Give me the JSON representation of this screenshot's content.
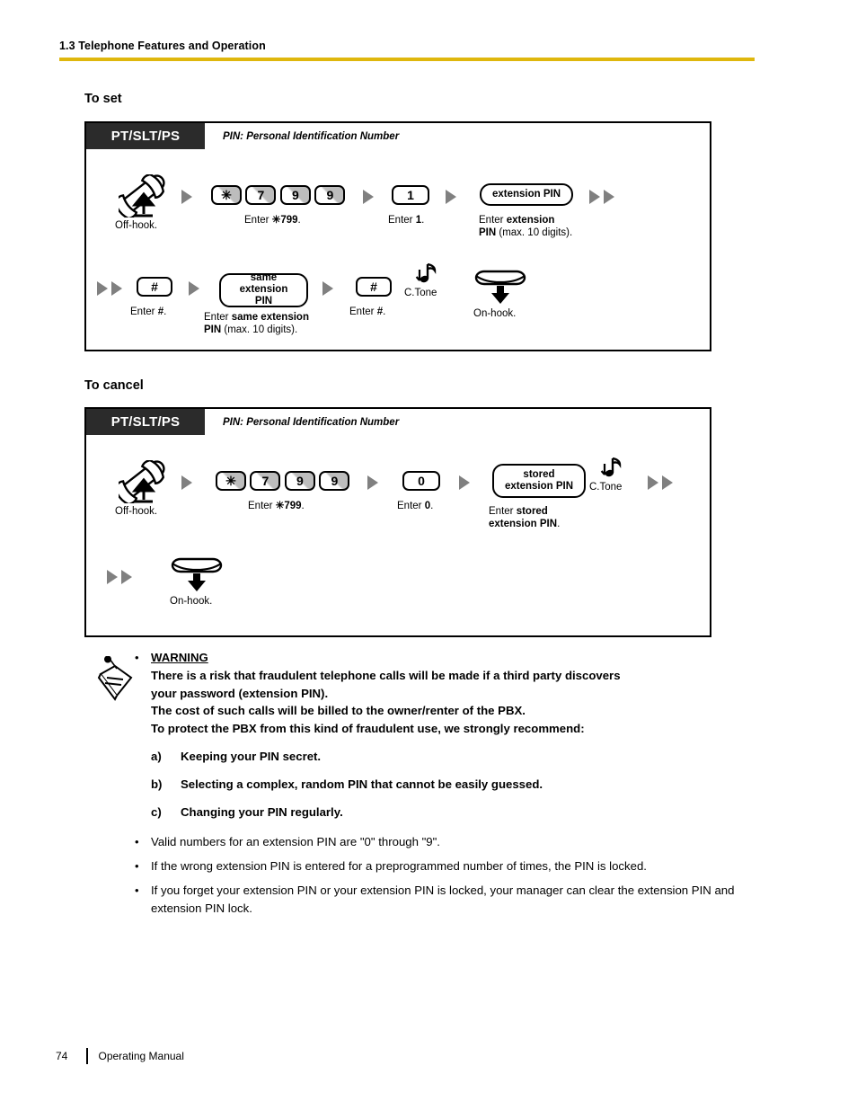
{
  "header": {
    "title": "1.3 Telephone Features and Operation",
    "rule_color": "#dfb70d"
  },
  "sections": [
    {
      "heading": "To set",
      "diagram": {
        "tag": "PT/SLT/PS",
        "note": "PIN: Personal Identification Number",
        "rows": [
          {
            "steps": [
              {
                "type": "offhook-icon",
                "icon": "handset-offhook-icon",
                "caption": "Off-hook."
              },
              {
                "type": "arrow",
                "icon": "step-arrow-icon"
              },
              {
                "type": "keys",
                "keys": [
                  "✳",
                  "7",
                  "9",
                  "9"
                ],
                "caption_pre": "Enter ",
                "caption_bold": "✳799",
                "caption_post": "."
              },
              {
                "type": "arrow",
                "icon": "step-arrow-icon"
              },
              {
                "type": "key-plain",
                "label": "1",
                "caption_pre": "Enter ",
                "caption_bold": "1",
                "caption_post": "."
              },
              {
                "type": "arrow",
                "icon": "step-arrow-icon"
              },
              {
                "type": "pill",
                "label": "extension PIN",
                "caption_line1_pre": "Enter ",
                "caption_line1_bold": "extension",
                "caption_line2_bold": "PIN",
                "caption_line2_post": " (max. 10 digits)."
              },
              {
                "type": "arrow-pair",
                "icon": "continuation-arrow-icon"
              }
            ]
          },
          {
            "steps": [
              {
                "type": "arrow-pair",
                "icon": "continuation-arrow-icon"
              },
              {
                "type": "key-hash",
                "label": "#",
                "caption_pre": "Enter ",
                "caption_bold": "#",
                "caption_post": "."
              },
              {
                "type": "arrow",
                "icon": "step-arrow-icon"
              },
              {
                "type": "pill",
                "label_line1": "same",
                "label_line2": "extension PIN",
                "caption_line1_pre": "Enter ",
                "caption_line1_bold": "same extension",
                "caption_line2_bold": "PIN",
                "caption_line2_post": " (max. 10 digits)."
              },
              {
                "type": "arrow",
                "icon": "step-arrow-icon"
              },
              {
                "type": "key-hash",
                "label": "#",
                "caption_pre": "Enter ",
                "caption_bold": "#",
                "caption_post": "."
              },
              {
                "type": "ctone",
                "icon": "confirmation-tone-icon",
                "label": "C.Tone"
              },
              {
                "type": "onhook-icon",
                "icon": "handset-onhook-icon",
                "caption": "On-hook."
              }
            ]
          }
        ]
      }
    },
    {
      "heading": "To cancel",
      "diagram": {
        "tag": "PT/SLT/PS",
        "note": "PIN: Personal Identification Number",
        "rows": [
          {
            "steps": [
              {
                "type": "offhook-icon",
                "icon": "handset-offhook-icon",
                "caption": "Off-hook."
              },
              {
                "type": "arrow",
                "icon": "step-arrow-icon"
              },
              {
                "type": "keys",
                "keys": [
                  "✳",
                  "7",
                  "9",
                  "9"
                ],
                "caption_pre": "Enter ",
                "caption_bold": "✳799",
                "caption_post": "."
              },
              {
                "type": "arrow",
                "icon": "step-arrow-icon"
              },
              {
                "type": "key-plain",
                "label": "0",
                "caption_pre": "Enter ",
                "caption_bold": "0",
                "caption_post": "."
              },
              {
                "type": "arrow",
                "icon": "step-arrow-icon"
              },
              {
                "type": "pill",
                "label_line1": "stored",
                "label_line2": "extension PIN",
                "caption_line1_pre": "Enter ",
                "caption_line1_bold": "stored",
                "caption_line2_bold": "extension PIN",
                "caption_line2_post": "."
              },
              {
                "type": "ctone",
                "icon": "confirmation-tone-icon",
                "label": "C.Tone"
              },
              {
                "type": "arrow-pair",
                "icon": "continuation-arrow-icon"
              }
            ]
          },
          {
            "steps": [
              {
                "type": "arrow-pair",
                "icon": "continuation-arrow-icon"
              },
              {
                "type": "onhook-icon",
                "icon": "handset-onhook-icon",
                "caption": "On-hook."
              }
            ]
          }
        ]
      }
    }
  ],
  "notes": {
    "icon": "memo-note-icon",
    "warning": {
      "title": "WARNING",
      "lines": [
        "There is a risk that fraudulent telephone calls will be made if a third party discovers",
        "your password (extension PIN).",
        "The cost of such calls will be billed to the owner/renter of the PBX.",
        "To protect the PBX from this kind of fraudulent use, we strongly recommend:"
      ],
      "items": [
        {
          "label": "a)",
          "text": "Keeping your PIN secret."
        },
        {
          "label": "b)",
          "text": "Selecting a complex, random PIN that cannot be easily guessed."
        },
        {
          "label": "c)",
          "text": "Changing your PIN regularly."
        }
      ]
    },
    "bullets": [
      "Valid numbers for an extension PIN are \"0\" through \"9\".",
      "If the wrong extension PIN is entered for a preprogrammed number of times, the PIN is locked.",
      "If you forget your extension PIN or your extension PIN is locked, your manager can clear the extension PIN and extension PIN lock."
    ],
    "bullet_glyph": "•"
  },
  "footer": {
    "page_number": "74",
    "document_name": "Operating Manual"
  }
}
